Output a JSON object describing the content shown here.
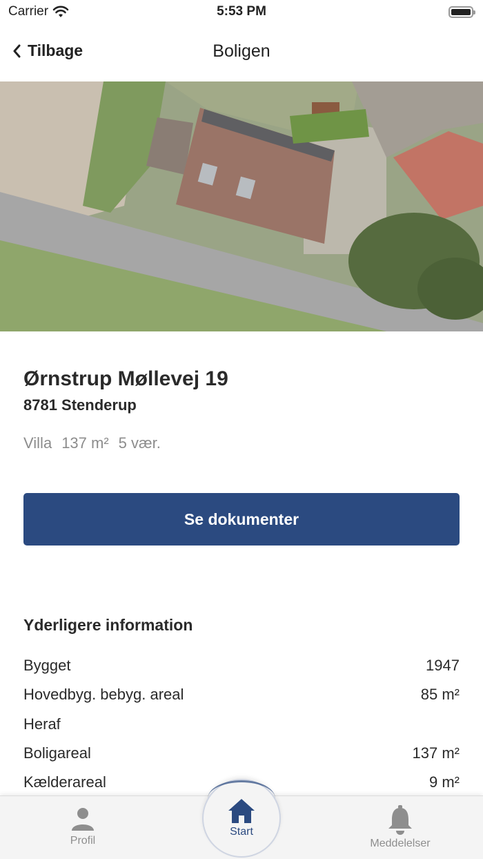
{
  "status_bar": {
    "carrier": "Carrier",
    "time": "5:53 PM"
  },
  "nav": {
    "back_label": "Tilbage",
    "title": "Boligen"
  },
  "property": {
    "address": "Ørnstrup Møllevej 19",
    "city": "8781 Stenderup",
    "type": "Villa",
    "area": "137 m²",
    "rooms": "5 vær."
  },
  "documents_button": "Se dokumenter",
  "info": {
    "title": "Yderligere information",
    "rows": [
      {
        "label": "Bygget",
        "value": "1947"
      },
      {
        "label": "Hovedbyg. bebyg. areal",
        "value": "85 m²"
      },
      {
        "label": "Heraf",
        "value": ""
      },
      {
        "label": "Boligareal",
        "value": "137 m²"
      },
      {
        "label": "Kælderareal",
        "value": "9 m²"
      }
    ]
  },
  "tabs": {
    "profil": "Profil",
    "start": "Start",
    "meddelelser": "Meddelelser"
  },
  "colors": {
    "primary": "#2b4a80",
    "inactive_tab": "#8e8e8e"
  }
}
